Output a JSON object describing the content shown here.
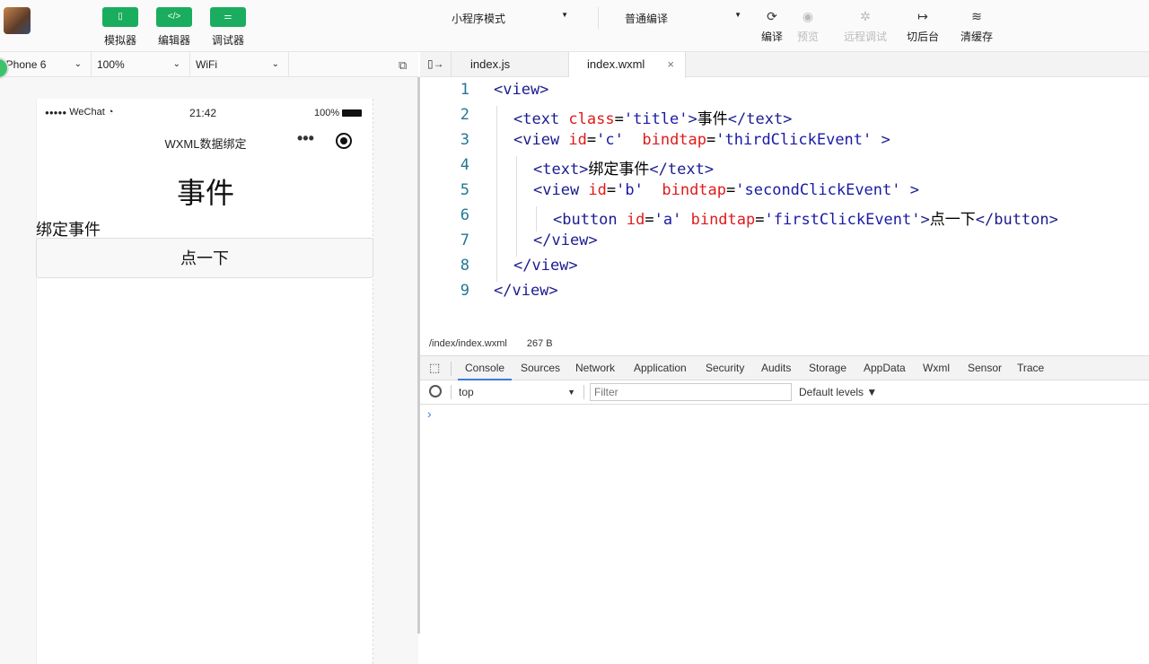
{
  "toolbar": {
    "buttons": [
      {
        "label": "模拟器",
        "icon": "phone-icon"
      },
      {
        "label": "编辑器",
        "icon": "code-icon"
      },
      {
        "label": "调试器",
        "icon": "debug-sliders-icon"
      }
    ],
    "mode": "小程序模式",
    "compile_mode": "普通编译",
    "tools": [
      {
        "label": "编译",
        "icon": "refresh-icon",
        "glyph": "⟳",
        "disabled": false
      },
      {
        "label": "预览",
        "icon": "eye-icon",
        "glyph": "◉",
        "disabled": true
      },
      {
        "label": "远程调试",
        "icon": "bug-icon",
        "glyph": "✲",
        "disabled": true
      },
      {
        "label": "切后台",
        "icon": "switch-background-icon",
        "glyph": "↦",
        "disabled": false
      },
      {
        "label": "清缓存",
        "icon": "layers-icon",
        "glyph": "≋",
        "disabled": false
      }
    ],
    "accent": "#1aad5f"
  },
  "simulator": {
    "device": "iPhone 6",
    "zoom": "100%",
    "network": "WiFi",
    "status": {
      "signal": "●●●●●",
      "carrier": "WeChat",
      "time": "21:42",
      "battery": "100%"
    },
    "nav_title": "WXML数据绑定",
    "page": {
      "title": "事件",
      "label": "绑定事件",
      "button": "点一下"
    }
  },
  "editor": {
    "tabs": [
      {
        "label": "index.js"
      },
      {
        "label": "index.wxml",
        "close": "×"
      }
    ],
    "lines": [
      [
        [
          "tag",
          "<view>"
        ]
      ],
      [
        [
          "tag",
          "<text "
        ],
        [
          "attr",
          "class"
        ],
        [
          "text",
          "="
        ],
        [
          "str",
          "'title'"
        ],
        [
          "tag",
          ">"
        ],
        [
          "text",
          "事件"
        ],
        [
          "tag",
          "</text>"
        ]
      ],
      [
        [
          "tag",
          "<view "
        ],
        [
          "attr",
          "id"
        ],
        [
          "text",
          "="
        ],
        [
          "str",
          "'c'"
        ],
        [
          "text",
          "  "
        ],
        [
          "attr",
          "bindtap"
        ],
        [
          "text",
          "="
        ],
        [
          "str",
          "'thirdClickEvent'"
        ],
        [
          "tag",
          " >"
        ]
      ],
      [
        [
          "tag",
          "<text>"
        ],
        [
          "text",
          "绑定事件"
        ],
        [
          "tag",
          "</text>"
        ]
      ],
      [
        [
          "tag",
          "<view "
        ],
        [
          "attr",
          "id"
        ],
        [
          "text",
          "="
        ],
        [
          "str",
          "'b'"
        ],
        [
          "text",
          "  "
        ],
        [
          "attr",
          "bindtap"
        ],
        [
          "text",
          "="
        ],
        [
          "str",
          "'secondClickEvent'"
        ],
        [
          "tag",
          " >"
        ]
      ],
      [
        [
          "tag",
          "<button "
        ],
        [
          "attr",
          "id"
        ],
        [
          "text",
          "="
        ],
        [
          "str",
          "'a'"
        ],
        [
          "text",
          " "
        ],
        [
          "attr",
          "bindtap"
        ],
        [
          "text",
          "="
        ],
        [
          "str",
          "'firstClickEvent'"
        ],
        [
          "tag",
          ">"
        ],
        [
          "text",
          "点一下"
        ],
        [
          "tag",
          "</button>"
        ]
      ],
      [
        [
          "tag",
          "</view>"
        ]
      ],
      [
        [
          "tag",
          "</view>"
        ]
      ],
      [
        [
          "tag",
          "</view>"
        ]
      ]
    ],
    "indents": [
      0,
      1,
      1,
      2,
      2,
      3,
      2,
      1,
      0
    ],
    "status": {
      "path": "/index/index.wxml",
      "size": "267 B"
    }
  },
  "devtools": {
    "tabs": [
      "Console",
      "Sources",
      "Network",
      "Application",
      "Security",
      "Audits",
      "Storage",
      "AppData",
      "Wxml",
      "Sensor",
      "Trace"
    ],
    "active": "Console",
    "context": "top",
    "filter_placeholder": "Filter",
    "levels": "Default levels ▼",
    "prompt": "›"
  }
}
